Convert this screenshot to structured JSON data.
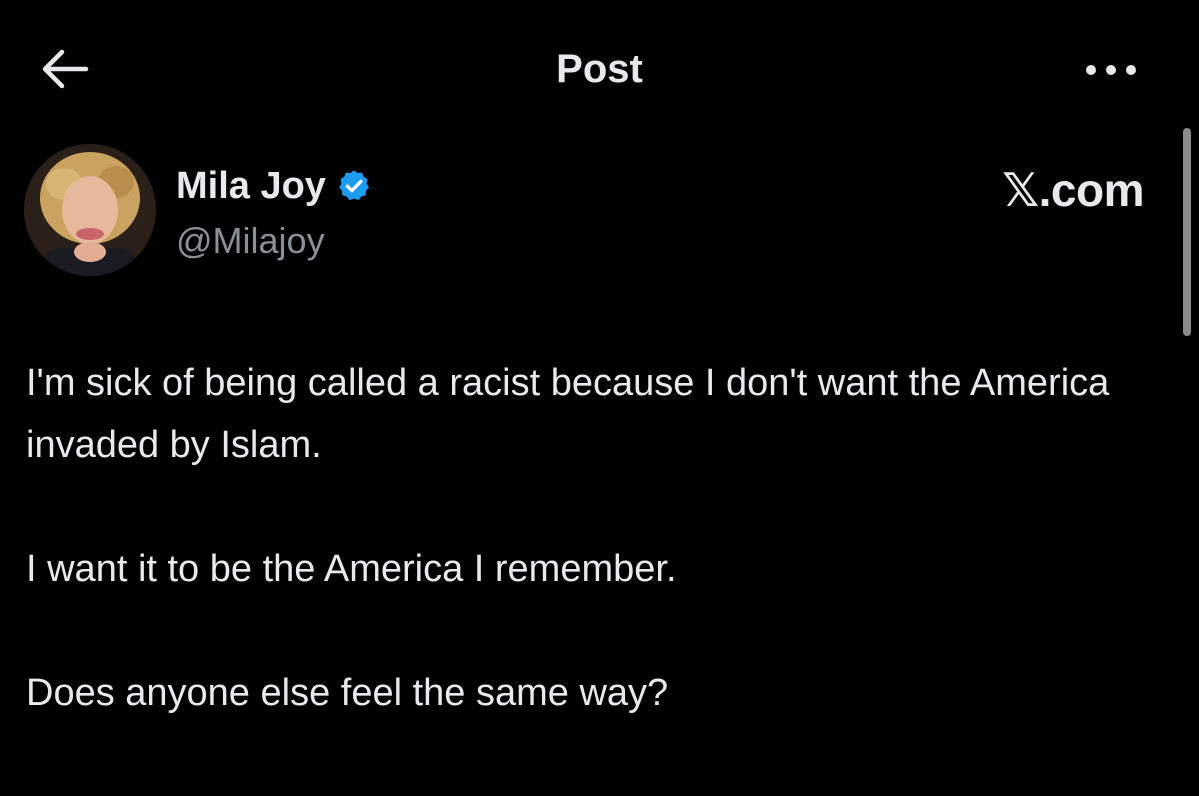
{
  "header": {
    "title": "Post",
    "back_icon": "arrow-left-icon",
    "more_icon": "more-horizontal-icon"
  },
  "author": {
    "display_name": "Mila Joy",
    "handle": "@Milajoy",
    "verified_icon": "verified-badge-icon",
    "verified_color": "#1d9bf0"
  },
  "watermark": "𝕏.com",
  "post": {
    "paragraphs": [
      "I'm sick of being called a racist because I don't want the America invaded by Islam.",
      "I want it to be the America I remember.",
      "Does anyone else feel the same way?"
    ]
  },
  "colors": {
    "background": "#000000",
    "text": "#e7e9ea",
    "secondary_text": "#8b9096"
  }
}
